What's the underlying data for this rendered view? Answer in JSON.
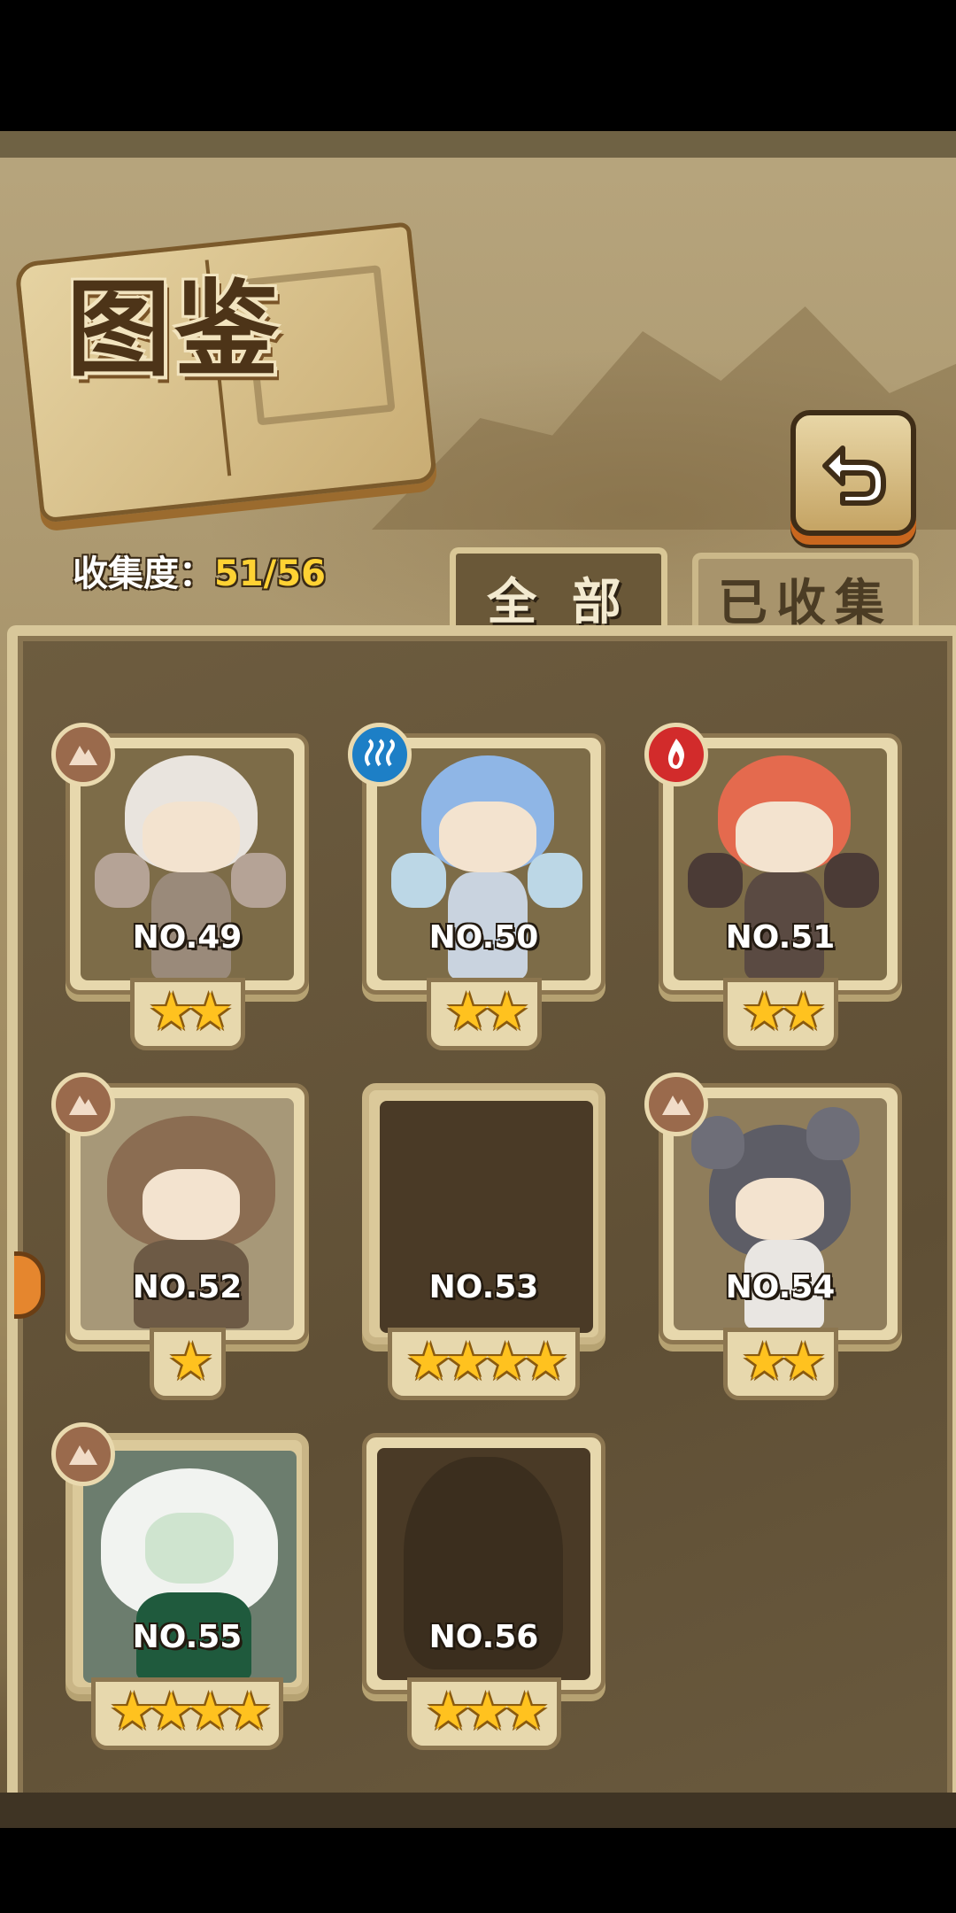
{
  "screen": {
    "title": "图鉴",
    "collection_label": "收集度：",
    "collection_count": "51/56",
    "collection_fraction": 0.9107
  },
  "back_button": {
    "icon": "return-arrow-icon"
  },
  "tabs": [
    {
      "label": "全 部",
      "selected": true
    },
    {
      "label": "已收集",
      "selected": false
    }
  ],
  "colors": {
    "star": "#ffc21f",
    "count_highlight": "#ffd233",
    "element_earth": "#9a6a4c",
    "element_water": "#1d7fc6",
    "element_fire": "#d22b2b"
  },
  "cards": [
    {
      "number": "NO.49",
      "stars": 2,
      "element": "earth",
      "element_icon": "earth-element-icon",
      "unlocked": true,
      "character": "stone-golem-girl-white"
    },
    {
      "number": "NO.50",
      "stars": 2,
      "element": "water",
      "element_icon": "water-element-icon",
      "unlocked": true,
      "character": "ice-golem-girl-blue"
    },
    {
      "number": "NO.51",
      "stars": 2,
      "element": "fire",
      "element_icon": "fire-element-icon",
      "unlocked": true,
      "character": "lava-golem-girl-red"
    },
    {
      "number": "NO.52",
      "stars": 1,
      "element": "earth",
      "element_icon": "earth-element-icon",
      "unlocked": true,
      "character": "treasure-chest-bear-girl"
    },
    {
      "number": "NO.53",
      "stars": 4,
      "element": null,
      "element_icon": null,
      "unlocked": false,
      "character": "locked-silhouette"
    },
    {
      "number": "NO.54",
      "stars": 2,
      "element": "earth",
      "element_icon": "earth-element-icon",
      "unlocked": true,
      "character": "gray-mouse-girl"
    },
    {
      "number": "NO.55",
      "stars": 4,
      "element": "earth",
      "element_icon": "earth-element-icon",
      "unlocked": true,
      "character": "white-hair-green-dress-queen"
    },
    {
      "number": "NO.56",
      "stars": 3,
      "element": null,
      "element_icon": null,
      "unlocked": false,
      "character": "locked-silhouette"
    }
  ]
}
